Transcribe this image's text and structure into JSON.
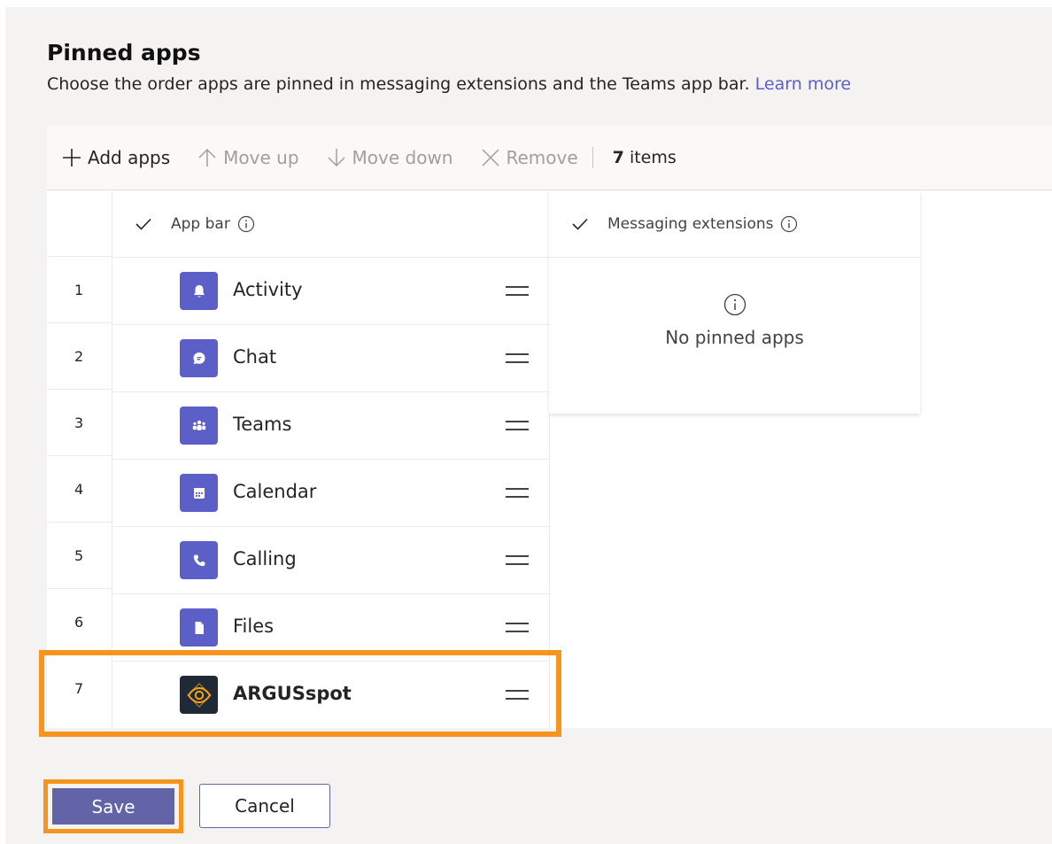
{
  "page": {
    "title": "Pinned apps",
    "subtitle": "Choose the order apps are pinned in messaging extensions and the Teams app bar.",
    "learn_more": "Learn more"
  },
  "toolbar": {
    "add_apps": "Add apps",
    "move_up": "Move up",
    "move_down": "Move down",
    "remove": "Remove",
    "count_number": "7",
    "count_label": "items"
  },
  "app_bar": {
    "header": "App bar",
    "rows": [
      {
        "num": "1",
        "name": "Activity",
        "icon": "bell-icon"
      },
      {
        "num": "2",
        "name": "Chat",
        "icon": "chat-icon"
      },
      {
        "num": "3",
        "name": "Teams",
        "icon": "teams-icon"
      },
      {
        "num": "4",
        "name": "Calendar",
        "icon": "calendar-icon"
      },
      {
        "num": "5",
        "name": "Calling",
        "icon": "phone-icon"
      },
      {
        "num": "6",
        "name": "Files",
        "icon": "file-icon"
      },
      {
        "num": "7",
        "name": "ARGUSspot",
        "icon": "argus-eye-icon"
      }
    ]
  },
  "messaging_extensions": {
    "header": "Messaging extensions",
    "empty_text": "No pinned apps"
  },
  "buttons": {
    "save": "Save",
    "cancel": "Cancel"
  },
  "colors": {
    "accent": "#6264a7",
    "app_icon": "#5b5fc7",
    "highlight": "#f7941d",
    "link": "#5b5fc7"
  }
}
